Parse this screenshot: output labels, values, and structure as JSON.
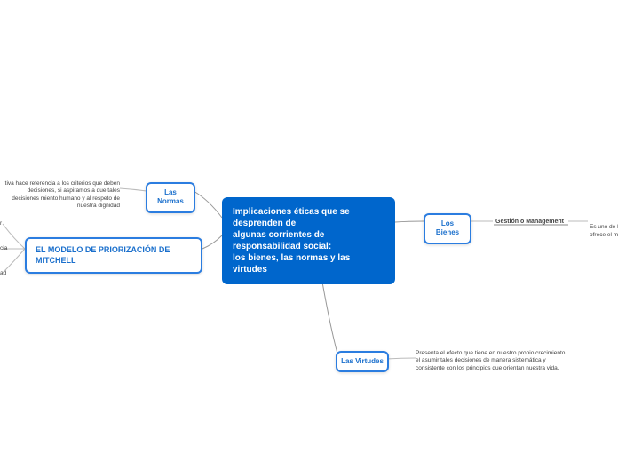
{
  "central": {
    "title": "Implicaciones éticas que se desprenden de\nalgunas corrientes de responsabilidad social:\nlos bienes, las normas y las virtudes"
  },
  "branches": {
    "normas": {
      "label": "Las Normas",
      "note": "tiva hace referencia a los criterios que deben decisiones, si aspiramos a que tales decisiones miento humano y al respeto de nuestra dignidad"
    },
    "mitchell": {
      "label": "EL MODELO DE PRIORIZACIÓN DE MITCHELL",
      "left_clips": [
        "r",
        "cia",
        "ad"
      ]
    },
    "bienes": {
      "label": "Los Bienes",
      "subnode": "Gestión o Management",
      "subnote": "Es uno de l\nofrece el m"
    },
    "virtudes": {
      "label": "Las Virtudes",
      "note": "Presenta el efecto que tiene en nuestro propio crecimiento el asumir tales decisiones de manera sistemática y consistente con los principios que orientan nuestra vida."
    }
  }
}
